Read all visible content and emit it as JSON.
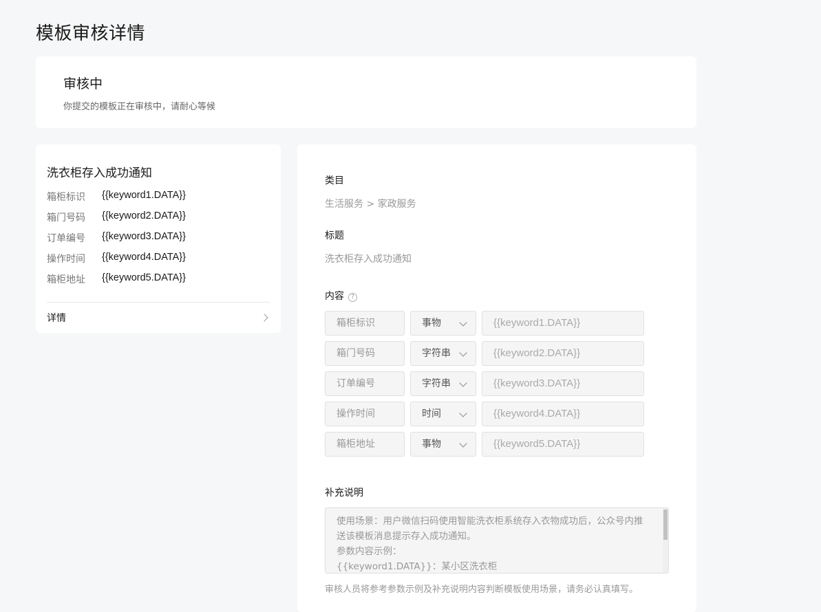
{
  "page": {
    "title": "模板审核详情"
  },
  "status": {
    "title": "审核中",
    "description": "你提交的模板正在审核中，请耐心等候"
  },
  "preview": {
    "title": "洗衣柜存入成功通知",
    "rows": [
      {
        "key": "箱柜标识",
        "value": "{{keyword1.DATA}}"
      },
      {
        "key": "箱门号码",
        "value": "{{keyword2.DATA}}"
      },
      {
        "key": "订单编号",
        "value": "{{keyword3.DATA}}"
      },
      {
        "key": "操作时间",
        "value": "{{keyword4.DATA}}"
      },
      {
        "key": "箱柜地址",
        "value": "{{keyword5.DATA}}"
      }
    ],
    "detail_label": "详情"
  },
  "form": {
    "category_label": "类目",
    "category_value": "生活服务 > 家政服务",
    "title_label": "标题",
    "title_value": "洗衣柜存入成功通知",
    "content_label": "内容",
    "help_icon": "question-circle-icon",
    "keywords": [
      {
        "name": "箱柜标识",
        "type": "事物",
        "data": "{{keyword1.DATA}}"
      },
      {
        "name": "箱门号码",
        "type": "字符串",
        "data": "{{keyword2.DATA}}"
      },
      {
        "name": "订单编号",
        "type": "字符串",
        "data": "{{keyword3.DATA}}"
      },
      {
        "name": "操作时间",
        "type": "时间",
        "data": "{{keyword4.DATA}}"
      },
      {
        "name": "箱柜地址",
        "type": "事物",
        "data": "{{keyword5.DATA}}"
      }
    ],
    "supplement_label": "补充说明",
    "supplement_text": "使用场景：用户微信扫码使用智能洗衣柜系统存入衣物成功后，公众号内推送该模板消息提示存入成功通知。\n参数内容示例：\n{{keyword1.DATA}}：某小区洗衣柜",
    "supplement_hint": "审核人员将参考参数示例及补充说明内容判断模板使用场景，请务必认真填写。"
  }
}
